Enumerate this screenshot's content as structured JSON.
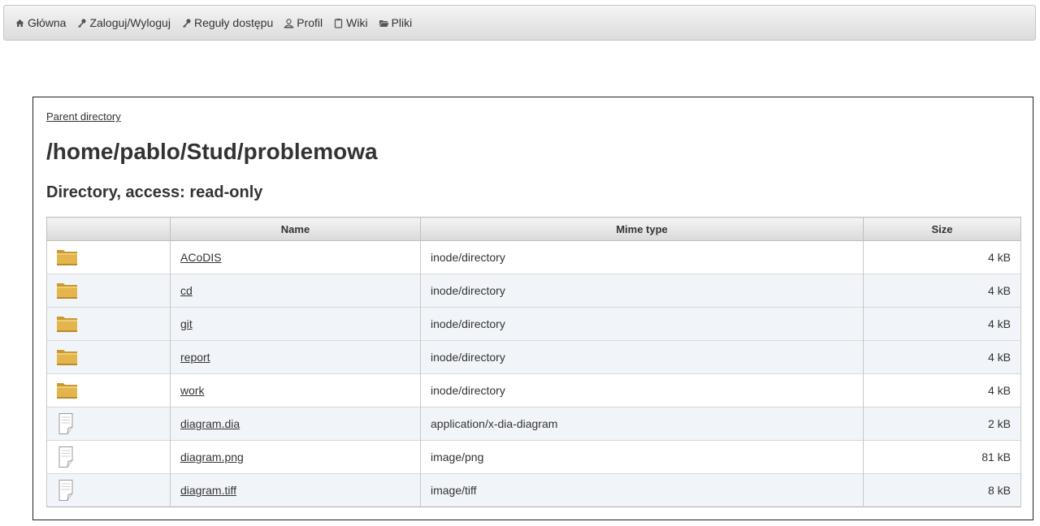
{
  "nav": {
    "items": [
      {
        "label": "Główna",
        "icon": "home-icon"
      },
      {
        "label": "Zaloguj/Wyloguj",
        "icon": "key-icon"
      },
      {
        "label": "Reguły dostępu",
        "icon": "key-icon"
      },
      {
        "label": "Profil",
        "icon": "user-icon"
      },
      {
        "label": "Wiki",
        "icon": "clipboard-icon"
      },
      {
        "label": "Pliki",
        "icon": "folder-open-icon"
      }
    ]
  },
  "page": {
    "parent_link": "Parent directory",
    "path": "/home/pablo/Stud/problemowa",
    "access": "Directory, access: read-only"
  },
  "table": {
    "columns": [
      "",
      "Name",
      "Mime type",
      "Size"
    ],
    "rows": [
      {
        "icon": "folder-icon",
        "name": "ACoDIS",
        "mime": "inode/directory",
        "size": "4  kB"
      },
      {
        "icon": "folder-icon",
        "name": "cd",
        "mime": "inode/directory",
        "size": "4  kB"
      },
      {
        "icon": "folder-icon",
        "name": "git",
        "mime": "inode/directory",
        "size": "4  kB"
      },
      {
        "icon": "folder-icon",
        "name": "report",
        "mime": "inode/directory",
        "size": "4  kB"
      },
      {
        "icon": "folder-icon",
        "name": "work",
        "mime": "inode/directory",
        "size": "4  kB"
      },
      {
        "icon": "file-icon",
        "name": "diagram.dia",
        "mime": "application/x-dia-diagram",
        "size": "2  kB"
      },
      {
        "icon": "file-icon",
        "name": "diagram.png",
        "mime": "image/png",
        "size": "81  kB"
      },
      {
        "icon": "file-icon",
        "name": "diagram.tiff",
        "mime": "image/tiff",
        "size": "8  kB"
      }
    ]
  },
  "colors": {
    "folder": "#e3b54c",
    "row_alt": "#f1f4f9",
    "text": "#333333"
  }
}
